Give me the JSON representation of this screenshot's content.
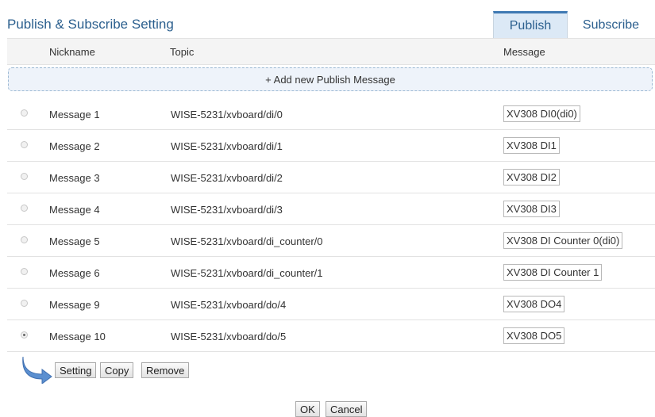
{
  "header": {
    "title": "Publish & Subscribe Setting",
    "tabs": [
      {
        "label": "Publish",
        "active": true
      },
      {
        "label": "Subscribe",
        "active": false
      }
    ]
  },
  "columns": {
    "nickname": "Nickname",
    "topic": "Topic",
    "message": "Message"
  },
  "add_label": "+ Add new Publish Message",
  "rows": [
    {
      "nickname": "Message 1",
      "topic": "WISE-5231/xvboard/di/0",
      "message": "XV308 DI0(di0)",
      "selected": false
    },
    {
      "nickname": "Message 2",
      "topic": "WISE-5231/xvboard/di/1",
      "message": "XV308 DI1",
      "selected": false
    },
    {
      "nickname": "Message 3",
      "topic": "WISE-5231/xvboard/di/2",
      "message": "XV308 DI2",
      "selected": false
    },
    {
      "nickname": "Message 4",
      "topic": "WISE-5231/xvboard/di/3",
      "message": "XV308 DI3",
      "selected": false
    },
    {
      "nickname": "Message 5",
      "topic": "WISE-5231/xvboard/di_counter/0",
      "message": "XV308 DI Counter 0(di0)",
      "selected": false
    },
    {
      "nickname": "Message 6",
      "topic": "WISE-5231/xvboard/di_counter/1",
      "message": "XV308 DI Counter 1",
      "selected": false
    },
    {
      "nickname": "Message 9",
      "topic": "WISE-5231/xvboard/do/4",
      "message": "XV308 DO4",
      "selected": false
    },
    {
      "nickname": "Message 10",
      "topic": "WISE-5231/xvboard/do/5",
      "message": "XV308 DO5",
      "selected": true
    }
  ],
  "actions": {
    "setting": "Setting",
    "copy": "Copy",
    "remove": "Remove"
  },
  "footer": {
    "ok": "OK",
    "cancel": "Cancel"
  },
  "colors": {
    "accent": "#2b5f8e",
    "tab_active_bg": "#dce9f6",
    "add_row_bg": "#eef3fa"
  },
  "icons": {
    "selection_arrow": "curved-arrow-icon"
  }
}
